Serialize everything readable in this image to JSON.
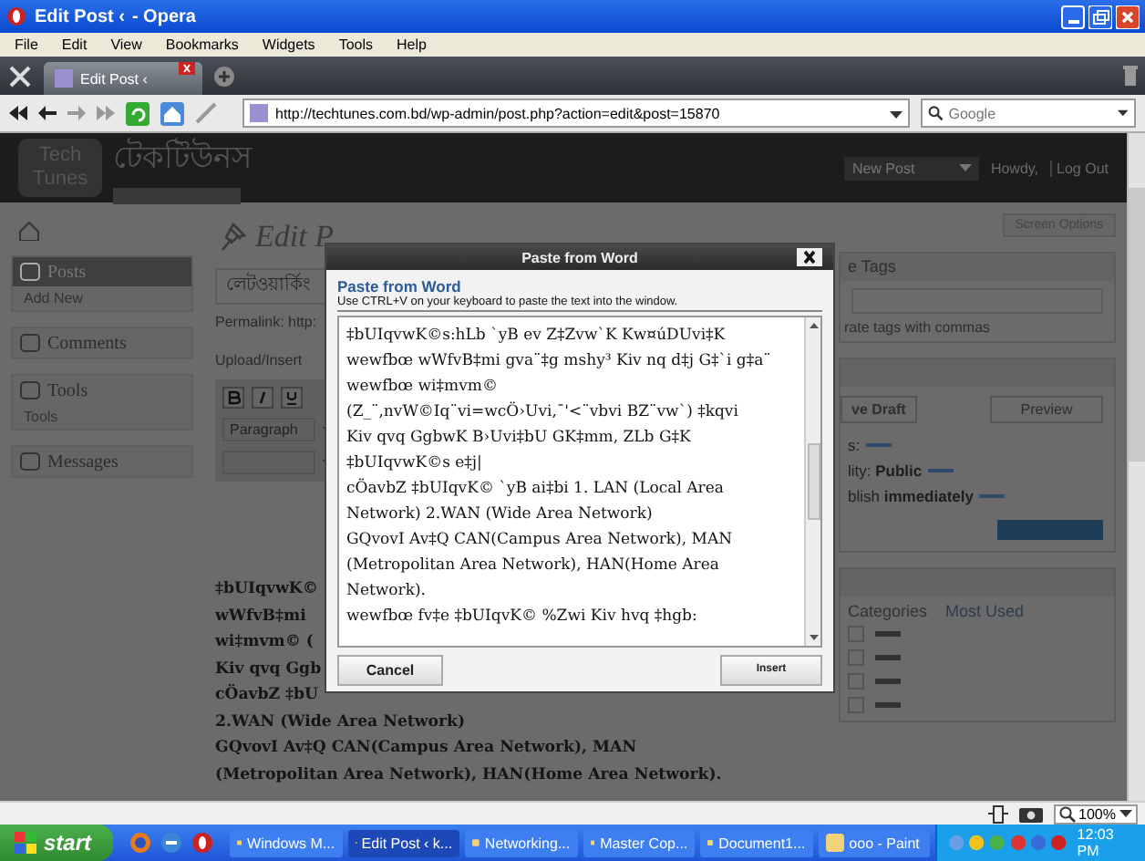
{
  "window": {
    "title": "Edit Post ‹",
    "app": "- Opera"
  },
  "menu": [
    "File",
    "Edit",
    "View",
    "Bookmarks",
    "Widgets",
    "Tools",
    "Help"
  ],
  "tabs": [
    {
      "label": "Edit Post ‹",
      "selected": true
    }
  ],
  "address": {
    "url": "http://techtunes.com.bd/wp-admin/post.php?action=edit&post=15870"
  },
  "search": {
    "placeholder": "Google"
  },
  "site": {
    "logo_top": "Tech",
    "logo_bottom": "Tunes",
    "name": "টেকটিউনস",
    "new_post": "New Post",
    "howdy": "Howdy,",
    "logout": "Log Out"
  },
  "sidebar": [
    {
      "label": "Posts",
      "selected": true,
      "children": [
        {
          "label": "Add New",
          "selected": false
        }
      ]
    },
    {
      "label": "Comments",
      "selected": false
    },
    {
      "label": "Tools",
      "selected": false,
      "children": [
        {
          "label": "Tools",
          "selected": false
        }
      ]
    },
    {
      "label": "Messages",
      "selected": false
    }
  ],
  "main": {
    "heading": "Edit P",
    "title_value": "লেটওয়ার্কিং",
    "permalink": "Permalink: http:",
    "upload": "Upload/Insert",
    "format": "Paragraph",
    "editor_lines": [
      "‡bUIqvwK©",
      "wWfvB‡mi",
      "wi‡mvm© (",
      "Kiv qvq Ggb",
      "cÖavbZ ‡bU",
      "2.WAN (Wide Area Network)",
      "GQvovI Av‡Q CAN(Campus Area Network), MAN",
      "(Metropolitan Area Network), HAN(Home Area Network)."
    ]
  },
  "right": {
    "screen_options": "Screen Options",
    "tags_heading": "e Tags",
    "tags_hint": "rate tags with commas",
    "save_draft": "ve Draft",
    "preview": "Preview",
    "status": "s:",
    "visibility": "lity: **Public**",
    "publish": "blish **immediately**",
    "cat_tabs": [
      {
        "label": "Categories",
        "selected": true
      },
      {
        "label": "Most Used",
        "selected": false
      }
    ],
    "categories": [
      {
        "checked": false
      },
      {
        "checked": false
      },
      {
        "checked": false
      },
      {
        "checked": false
      }
    ]
  },
  "dialog": {
    "title": "Paste from Word",
    "heading": "Paste from Word",
    "hint": "Use CTRL+V on your keyboard to paste the text into the window.",
    "lines": [
      "‡bUIqvwK©s:hLb `yB ev Z‡Zvw`K Kw¤úDUvi‡K",
      "wewfbœ wWfvB‡mi gva¨‡g mshy³ Kiv nq d‡j G‡`i g‡a¨",
      "wewfbœ wi‡mvm©",
      "(Z_¨,nvW©Iq¨vi=wcÖ›Uvi,¯'<¨vbvi BZ¨vw`) ‡kqvi",
      "Kiv qvq GgbwK B›Uvi‡bU GK‡mm, ZLb G‡K",
      "‡bUIqvwK©s e‡j|",
      "cÖavbZ ‡bUIqvK© `yB ai‡bi 1. LAN (Local Area",
      "Network) 2.WAN (Wide Area Network)",
      "GQvovI Av‡Q CAN(Campus Area Network), MAN",
      "(Metropolitan Area Network), HAN(Home Area",
      "Network).",
      "wewfbœ fv‡e ‡bUIqvK© %Zwi Kiv hvq ‡hgb:"
    ],
    "buttons": [
      {
        "kind": "cancel",
        "label": "Cancel"
      },
      {
        "kind": "insert",
        "label": "Insert"
      }
    ]
  },
  "status_bar": {
    "zoom": "100%"
  },
  "taskbar": {
    "start": "start",
    "tasks": [
      {
        "label": "Windows M...",
        "selected": false
      },
      {
        "label": "Edit Post ‹ k...",
        "selected": true
      },
      {
        "label": "Networking...",
        "selected": false
      },
      {
        "label": "Master Cop...",
        "selected": false
      },
      {
        "label": "Document1...",
        "selected": false
      },
      {
        "label": "ooo - Paint",
        "selected": false
      }
    ],
    "time": "12:03 PM"
  }
}
